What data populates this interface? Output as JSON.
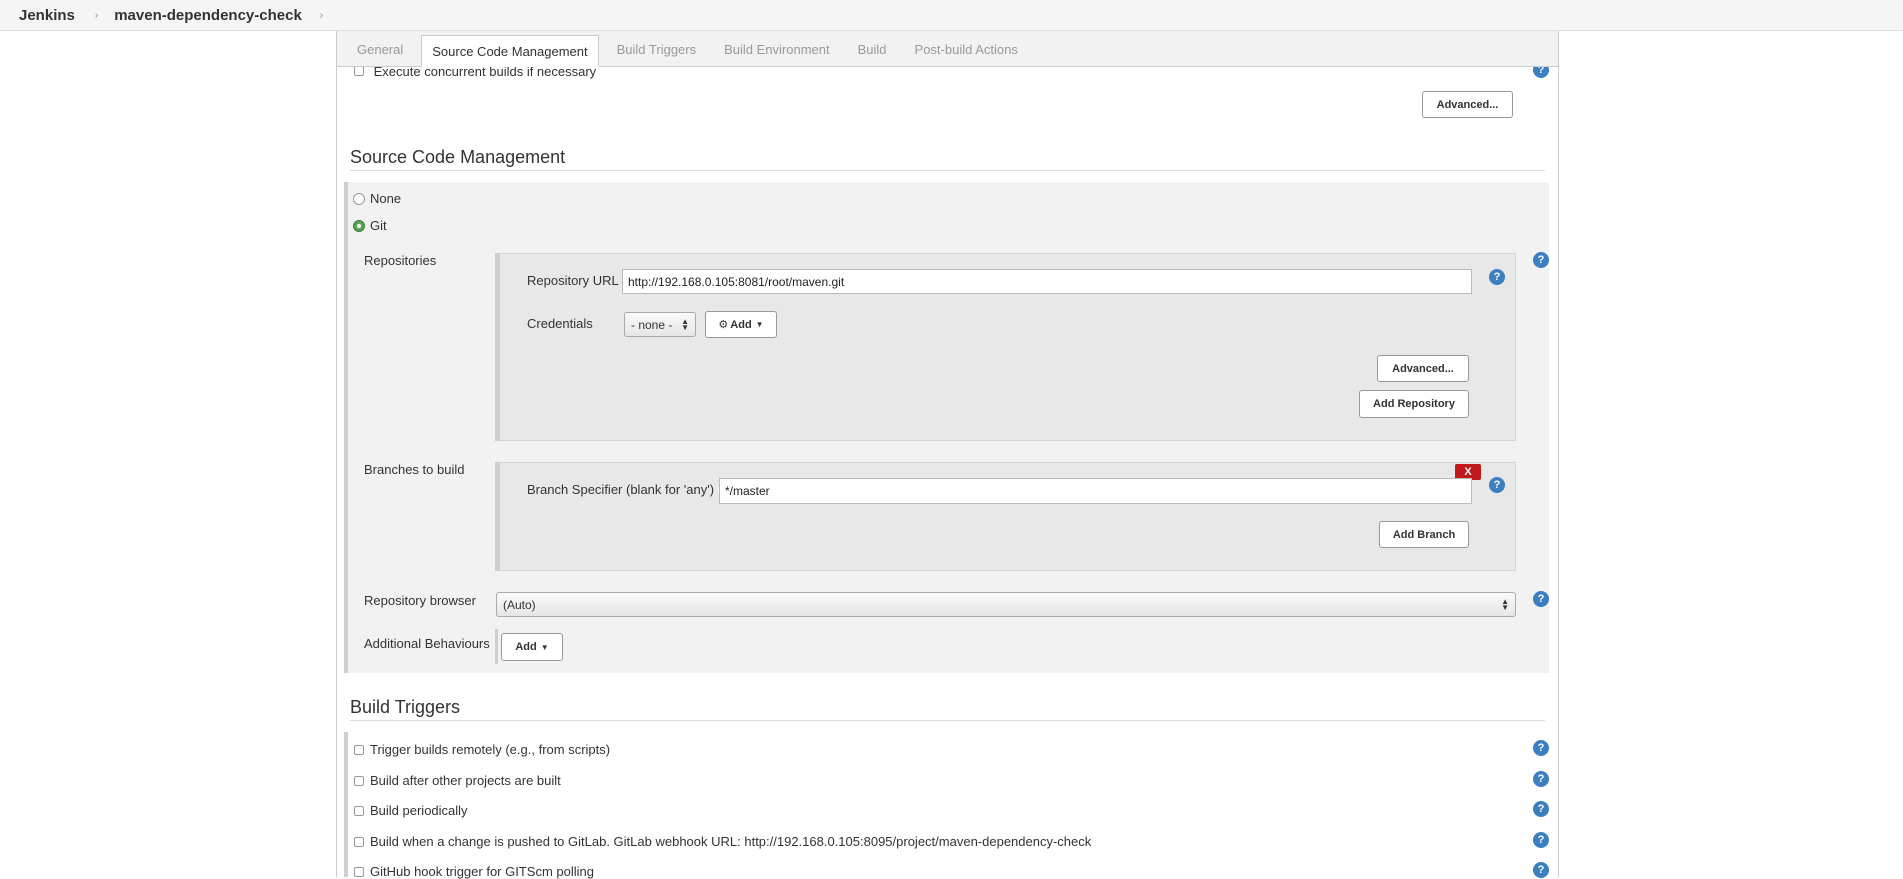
{
  "breadcrumb": {
    "home": "Jenkins",
    "job": "maven-dependency-check"
  },
  "tabs": [
    {
      "label": "General"
    },
    {
      "label": "Source Code Management"
    },
    {
      "label": "Build Triggers"
    },
    {
      "label": "Build Environment"
    },
    {
      "label": "Build"
    },
    {
      "label": "Post-build Actions"
    }
  ],
  "general": {
    "concurrent_label": "Execute concurrent builds if necessary",
    "advanced_label": "Advanced..."
  },
  "scm": {
    "title": "Source Code Management",
    "none_label": "None",
    "git_label": "Git",
    "repositories_label": "Repositories",
    "repo_url_label": "Repository URL",
    "repo_url_value": "http://192.168.0.105:8081/root/maven.git",
    "credentials_label": "Credentials",
    "credentials_value": "- none -",
    "add_label": "Add",
    "advanced_label": "Advanced...",
    "add_repository_label": "Add Repository",
    "branches_label": "Branches to build",
    "branch_specifier_label": "Branch Specifier (blank for 'any')",
    "branch_specifier_value": "*/master",
    "delete_label": "X",
    "add_branch_label": "Add Branch",
    "repo_browser_label": "Repository browser",
    "repo_browser_value": "(Auto)",
    "additional_behaviours_label": "Additional Behaviours",
    "additional_add_label": "Add"
  },
  "triggers": {
    "title": "Build Triggers",
    "items": [
      {
        "label": "Trigger builds remotely (e.g., from scripts)"
      },
      {
        "label": "Build after other projects are built"
      },
      {
        "label": "Build periodically"
      },
      {
        "label": "Build when a change is pushed to GitLab. GitLab webhook URL: http://192.168.0.105:8095/project/maven-dependency-check"
      },
      {
        "label": "GitHub hook trigger for GITScm polling"
      }
    ]
  },
  "help_glyph": "?",
  "icons": [
    "chevron-right-icon",
    "help-icon",
    "key-icon",
    "caret-down-icon",
    "select-arrows-icon"
  ],
  "colors": {
    "help_blue": "#3c7fc1",
    "delete_red": "#c11a1a",
    "radio_green": "#5aa55a"
  }
}
